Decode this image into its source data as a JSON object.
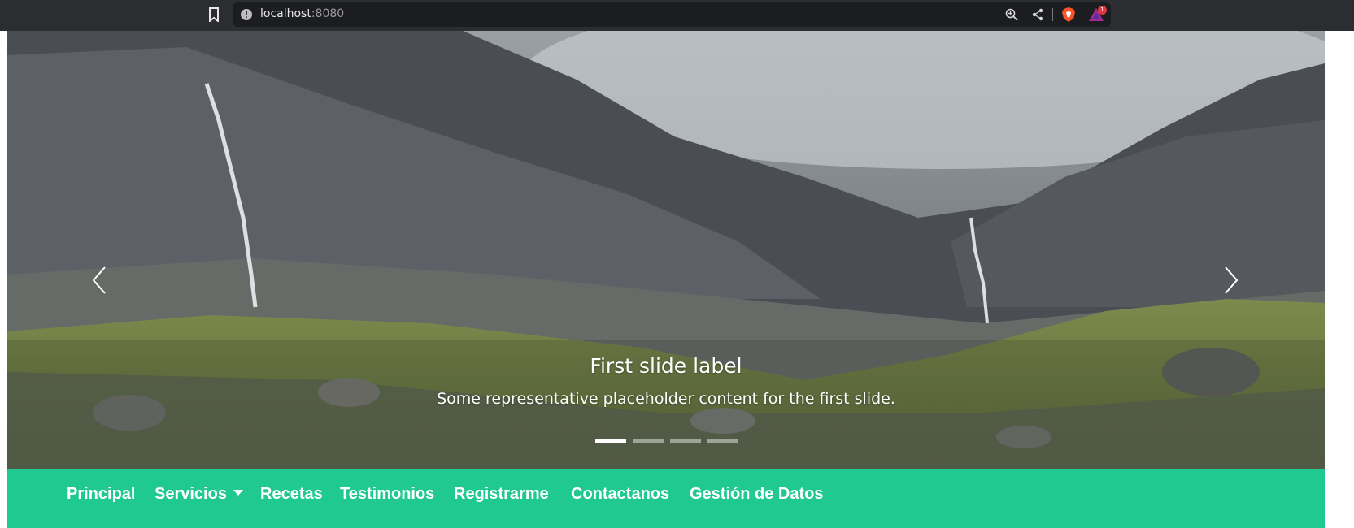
{
  "browser": {
    "url_host": "localhost",
    "url_port": ":8080",
    "rewards_badge": "1"
  },
  "carousel": {
    "caption_title": "First slide label",
    "caption_text": "Some representative placeholder content for the first slide.",
    "slides_total": 4,
    "active_slide": 1
  },
  "navbar": {
    "items": [
      {
        "label": "Principal"
      },
      {
        "label": "Servicios"
      },
      {
        "label": "Recetas"
      },
      {
        "label": "Testimonios"
      },
      {
        "label": "Registrarme"
      },
      {
        "label": "Contactanos"
      },
      {
        "label": "Gestión de Datos"
      }
    ]
  },
  "colors": {
    "navbar_bg": "#20c98f",
    "chrome_bg": "#2b2d31",
    "text_white": "#ffffff"
  }
}
